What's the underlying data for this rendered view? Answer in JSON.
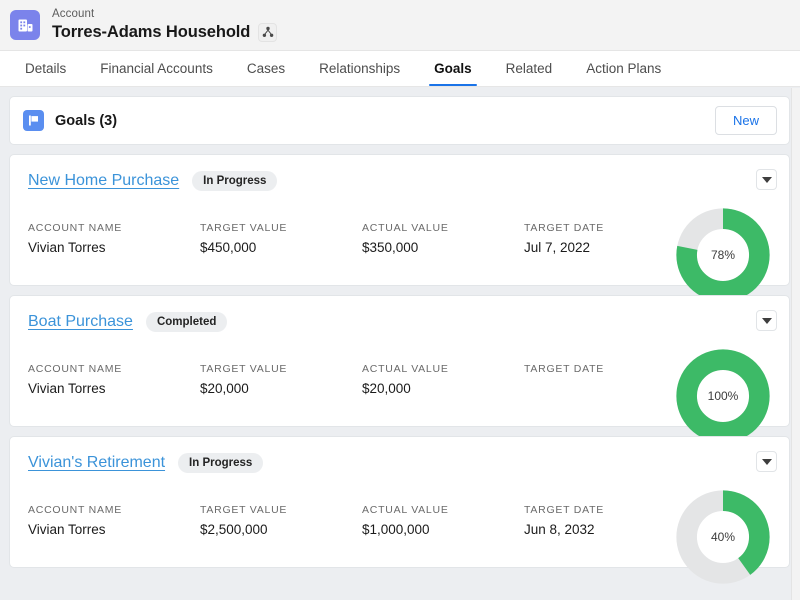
{
  "header": {
    "eyebrow": "Account",
    "title": "Torres-Adams Household",
    "app_icon": "account-building-icon",
    "hierarchy_icon": "hierarchy-icon"
  },
  "tabs": [
    {
      "label": "Details",
      "active": false
    },
    {
      "label": "Financial Accounts",
      "active": false
    },
    {
      "label": "Cases",
      "active": false
    },
    {
      "label": "Relationships",
      "active": false
    },
    {
      "label": "Goals",
      "active": true
    },
    {
      "label": "Related",
      "active": false
    },
    {
      "label": "Action Plans",
      "active": false
    }
  ],
  "goals_panel": {
    "icon": "flag-icon",
    "title": "Goals (3)",
    "new_label": "New"
  },
  "field_labels": {
    "account_name": "ACCOUNT NAME",
    "target_value": "TARGET VALUE",
    "actual_value": "ACTUAL VALUE",
    "target_date": "TARGET DATE"
  },
  "colors": {
    "accent_blue": "#1a73e8",
    "link_blue": "#3b93d9",
    "progress_green": "#3dba67",
    "track_gray": "#e4e5e6",
    "badge_gray": "#eceef0"
  },
  "goals": [
    {
      "name": "New Home Purchase",
      "status": "In Progress",
      "account_name": "Vivian Torres",
      "target_value": "$450,000",
      "actual_value": "$350,000",
      "target_date": "Jul 7, 2022",
      "percent_label": "78%",
      "percent": 78
    },
    {
      "name": "Boat Purchase",
      "status": "Completed",
      "account_name": "Vivian Torres",
      "target_value": "$20,000",
      "actual_value": "$20,000",
      "target_date": "",
      "percent_label": "100%",
      "percent": 100
    },
    {
      "name": "Vivian's Retirement",
      "status": "In Progress",
      "account_name": "Vivian Torres",
      "target_value": "$2,500,000",
      "actual_value": "$1,000,000",
      "target_date": "Jun 8, 2032",
      "percent_label": "40%",
      "percent": 40
    }
  ],
  "chart_data": {
    "type": "pie",
    "title": "Goal progress donuts",
    "series": [
      {
        "name": "New Home Purchase",
        "values": [
          78,
          22
        ],
        "labels": [
          "Complete",
          "Remaining"
        ]
      },
      {
        "name": "Boat Purchase",
        "values": [
          100,
          0
        ],
        "labels": [
          "Complete",
          "Remaining"
        ]
      },
      {
        "name": "Vivian's Retirement",
        "values": [
          40,
          60
        ],
        "labels": [
          "Complete",
          "Remaining"
        ]
      }
    ],
    "unit": "%"
  }
}
